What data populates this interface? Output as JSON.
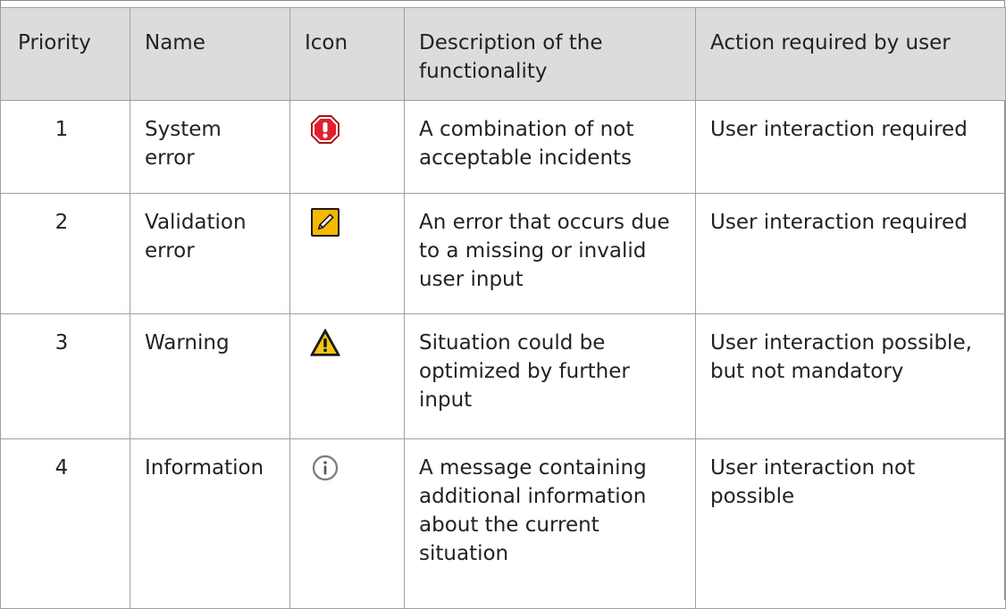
{
  "table": {
    "headers": {
      "priority": "Priority",
      "name": "Name",
      "icon": "Icon",
      "description": "Description of the functionality",
      "action": "Action required by user"
    },
    "rows": [
      {
        "priority": "1",
        "name": "System error",
        "icon": "system-error-icon",
        "description": "A combination of not acceptable incidents",
        "action": "User interaction required"
      },
      {
        "priority": "2",
        "name": "Validation error",
        "icon": "validation-error-icon",
        "description": "An error that occurs due to a missing or invalid user input",
        "action": "User interaction required"
      },
      {
        "priority": "3",
        "name": "Warning",
        "icon": "warning-icon",
        "description": "Situation could be optimized by further input",
        "action": "User interaction possible, but not mandatory"
      },
      {
        "priority": "4",
        "name": "Information",
        "icon": "information-icon",
        "description": "A message containing additional information about the current situation",
        "action": "User interaction not possible"
      }
    ]
  },
  "colors": {
    "header_bg": "#dcdcdc",
    "border": "#a0a0a0",
    "error_red": "#e0202e",
    "validation_yellow": "#f5b800",
    "warning_yellow": "#f5c518",
    "info_gray": "#7a7a7a"
  }
}
